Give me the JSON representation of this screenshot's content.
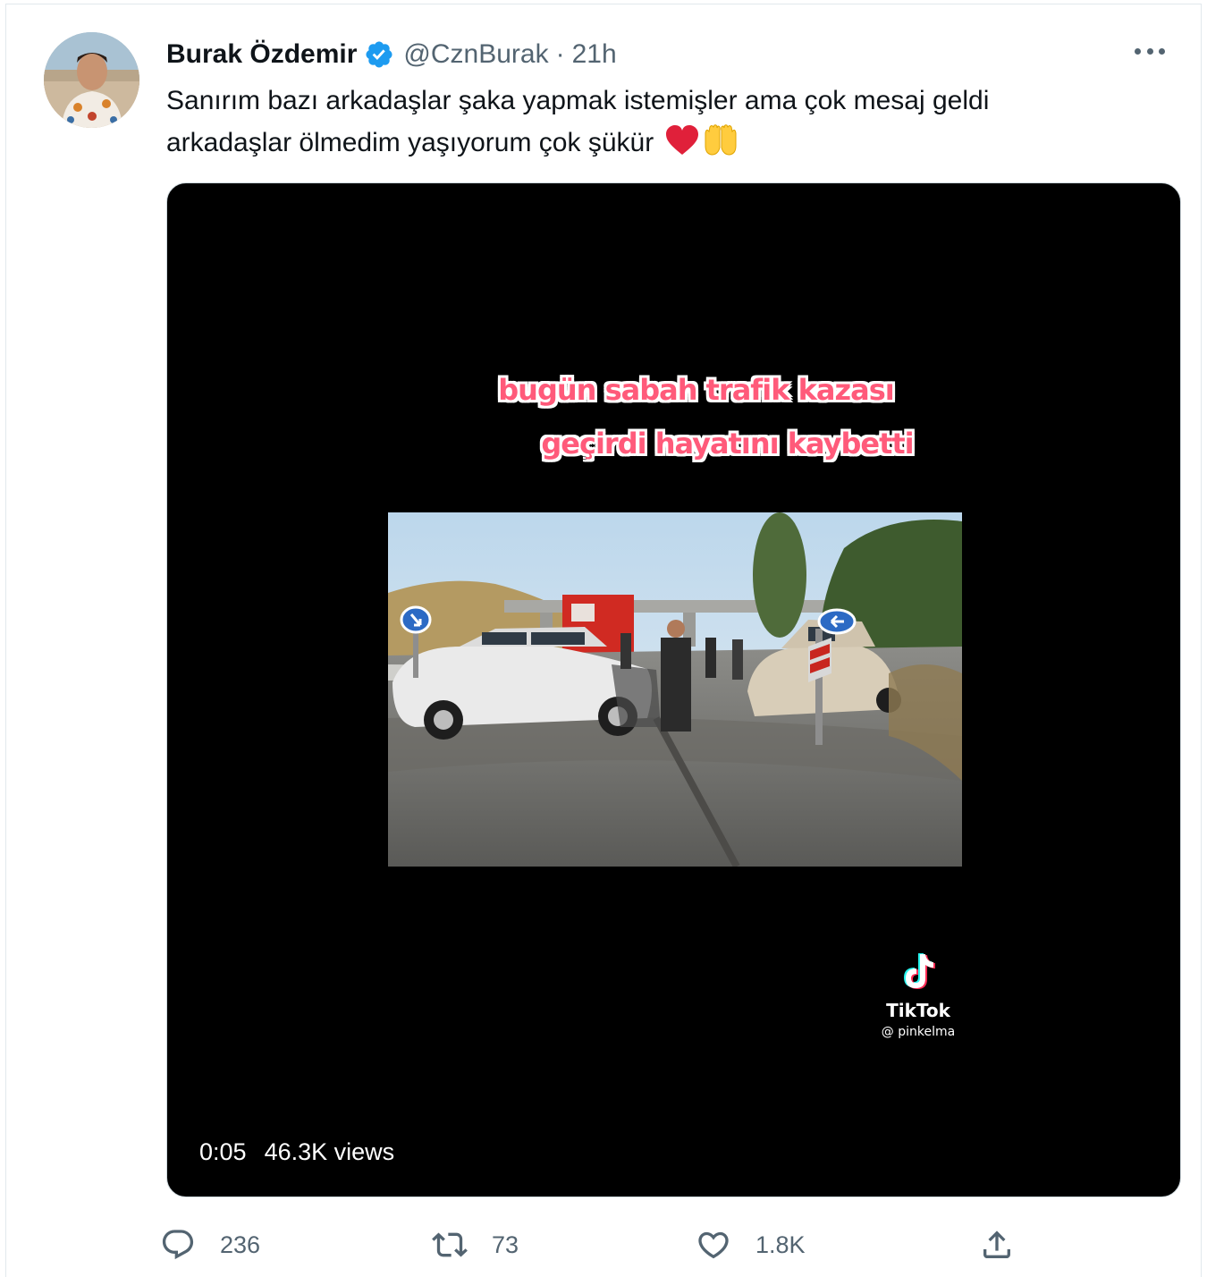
{
  "tweet": {
    "author_name": "Burak Özdemir",
    "handle": "@CznBurak",
    "separator": "·",
    "time": "21h",
    "text_line1": "Sanırım bazı arkadaşlar şaka yapmak istemişler ama çok mesaj geldi",
    "text_line2": "arkadaşlar ölmedim yaşıyorum çok şükür",
    "text_emojis": [
      "red-heart",
      "raising-hands"
    ]
  },
  "media": {
    "caption_line1": "bugün sabah trafik kazası",
    "caption_line2": "geçirdi hayatını kaybetti",
    "watermark_brand": "TikTok",
    "watermark_user": "@ pinkelma",
    "duration": "0:05",
    "views": "46.3K views"
  },
  "actions": {
    "replies": "236",
    "retweets": "73",
    "likes": "1.8K"
  },
  "colors": {
    "text_primary": "#0f1419",
    "text_secondary": "#536471",
    "verified_blue": "#1d9bf0",
    "caption_pink": "#ff5a7a",
    "media_bg": "#000000"
  }
}
